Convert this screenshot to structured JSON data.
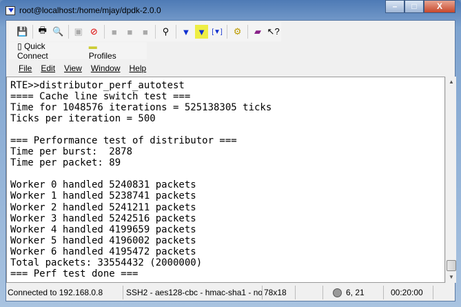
{
  "window": {
    "title": "root@localhost:/home/mjay/dpdk-2.0.0",
    "minimize": "–",
    "maximize": "□",
    "close": "X"
  },
  "quick": {
    "connect": "Quick Connect",
    "profiles": "Profiles"
  },
  "menu": [
    "File",
    "Edit",
    "View",
    "Window",
    "Help"
  ],
  "terminal": {
    "lines": [
      "RTE>>distributor_perf_autotest",
      "==== Cache line switch test ===",
      "Time for 1048576 iterations = 525138305 ticks",
      "Ticks per iteration = 500",
      "",
      "=== Performance test of distributor ===",
      "Time per burst:  2878",
      "Time per packet: 89",
      "",
      "Worker 0 handled 5240831 packets",
      "Worker 1 handled 5238741 packets",
      "Worker 2 handled 5241211 packets",
      "Worker 3 handled 5242516 packets",
      "Worker 4 handled 4199659 packets",
      "Worker 5 handled 4196002 packets",
      "Worker 6 handled 4195472 packets",
      "Total packets: 33554432 (2000000)",
      "=== Perf test done ==="
    ]
  },
  "status": {
    "connection": "Connected to 192.168.0.8",
    "cipher": "SSH2 - aes128-cbc - hmac-sha1 - no",
    "size": "78x18",
    "cursor": "6, 21",
    "time": "00:20:00"
  }
}
